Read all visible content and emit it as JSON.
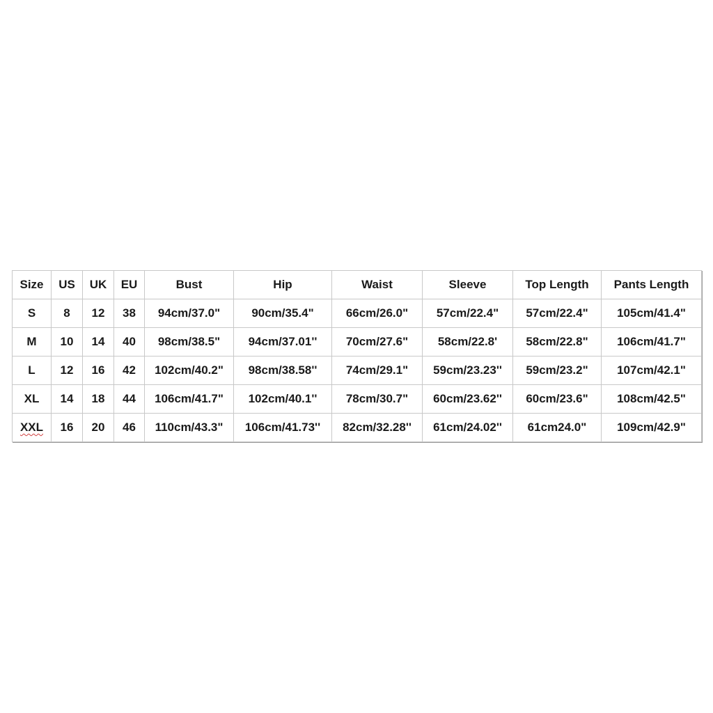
{
  "size_chart": {
    "headers": [
      "Size",
      "US",
      "UK",
      "EU",
      "Bust",
      "Hip",
      "Waist",
      "Sleeve",
      "Top Length",
      "Pants Length"
    ],
    "rows": [
      [
        "S",
        "8",
        "12",
        "38",
        "94cm/37.0\"",
        "90cm/35.4\"",
        "66cm/26.0\"",
        "57cm/22.4\"",
        "57cm/22.4\"",
        "105cm/41.4\""
      ],
      [
        "M",
        "10",
        "14",
        "40",
        "98cm/38.5\"",
        "94cm/37.01''",
        "70cm/27.6\"",
        "58cm/22.8'",
        "58cm/22.8\"",
        "106cm/41.7\""
      ],
      [
        "L",
        "12",
        "16",
        "42",
        "102cm/40.2\"",
        "98cm/38.58''",
        "74cm/29.1\"",
        "59cm/23.23''",
        "59cm/23.2\"",
        "107cm/42.1\""
      ],
      [
        "XL",
        "14",
        "18",
        "44",
        "106cm/41.7\"",
        "102cm/40.1''",
        "78cm/30.7\"",
        "60cm/23.62''",
        "60cm/23.6\"",
        "108cm/42.5\""
      ],
      [
        "XXL",
        "16",
        "20",
        "46",
        "110cm/43.3\"",
        "106cm/41.73''",
        "82cm/32.28''",
        "61cm/24.02''",
        "61cm24.0\"",
        "109cm/42.9\""
      ]
    ]
  }
}
